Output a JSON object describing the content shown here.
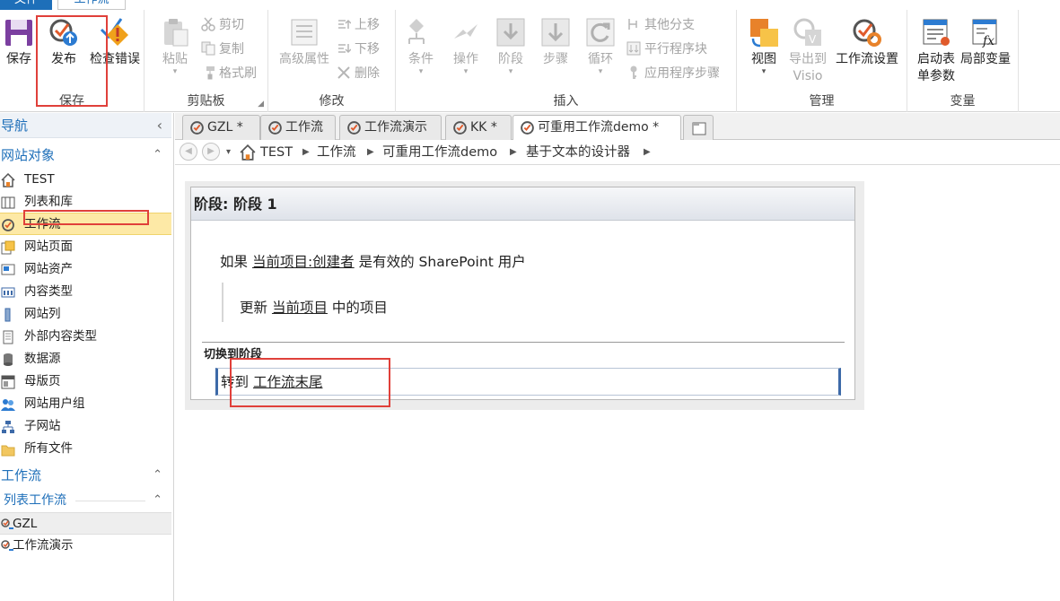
{
  "menu": {
    "file": "文件",
    "workflow": "工作流"
  },
  "ribbon": {
    "save_group": {
      "label": "保存",
      "save": "保存",
      "publish": "发布",
      "check": "检查错误"
    },
    "clipboard": {
      "label": "剪贴板",
      "paste": "粘贴",
      "cut": "剪切",
      "copy": "复制",
      "format_painter": "格式刷"
    },
    "modify": {
      "label": "修改",
      "adv_props": "高级属性",
      "move_up": "上移",
      "move_down": "下移",
      "delete": "删除"
    },
    "insert": {
      "label": "插入",
      "condition": "条件",
      "action": "操作",
      "stage": "阶段",
      "step": "步骤",
      "loop": "循环",
      "else_branch": "其他分支",
      "parallel": "平行程序块",
      "app_step": "应用程序步骤"
    },
    "manage": {
      "label": "管理",
      "view": "视图",
      "export_visio_1": "导出到",
      "export_visio_2": "Visio",
      "wf_settings": "工作流设置"
    },
    "variables": {
      "label": "变量",
      "init_params_1": "启动表",
      "init_params_2": "单参数",
      "local_vars": "局部变量"
    }
  },
  "nav": {
    "title": "导航",
    "site_objects": "网站对象",
    "items": [
      "TEST",
      "列表和库",
      "工作流",
      "网站页面",
      "网站资产",
      "内容类型",
      "网站列",
      "外部内容类型",
      "数据源",
      "母版页",
      "网站用户组",
      "子网站",
      "所有文件"
    ],
    "workflows_header": "工作流",
    "list_workflows_header": "列表工作流",
    "list_workflows": [
      "GZL",
      "工作流演示"
    ]
  },
  "tabs": [
    {
      "label": "GZL",
      "mod": "*"
    },
    {
      "label": "工作流",
      "mod": ""
    },
    {
      "label": "工作流演示",
      "mod": ""
    },
    {
      "label": "KK",
      "mod": "*"
    },
    {
      "label": "可重用工作流demo",
      "mod": "*",
      "close": "×"
    }
  ],
  "breadcrumb": [
    "TEST",
    "工作流",
    "可重用工作流demo",
    "基于文本的设计器"
  ],
  "designer": {
    "stage_title": "阶段: 阶段 1",
    "cond_prefix": "如果",
    "cond_field": "当前项目:创建者",
    "cond_suffix": "是有效的 SharePoint 用户",
    "action_prefix": "更新",
    "action_link": "当前项目",
    "action_suffix": "中的项目",
    "transition_label": "切换到阶段",
    "goto_prefix": "转到",
    "goto_link": "工作流末尾"
  }
}
